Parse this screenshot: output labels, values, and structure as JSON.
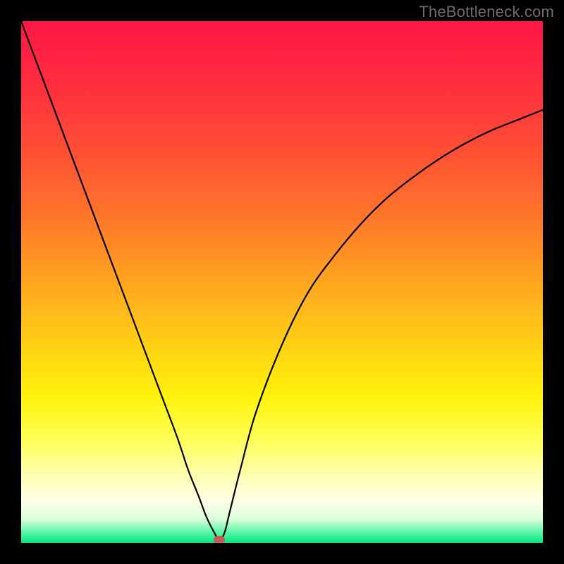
{
  "watermark": "TheBottleneck.com",
  "chart_data": {
    "type": "line",
    "title": "",
    "xlabel": "",
    "ylabel": "",
    "xlim": [
      0,
      100
    ],
    "ylim": [
      0,
      100
    ],
    "grid": false,
    "legend": false,
    "background": {
      "gradient_stops": [
        {
          "pos": 0.0,
          "color": "#ff1745"
        },
        {
          "pos": 0.12,
          "color": "#ff2d3f"
        },
        {
          "pos": 0.25,
          "color": "#ff5034"
        },
        {
          "pos": 0.38,
          "color": "#ff782a"
        },
        {
          "pos": 0.5,
          "color": "#ffa51f"
        },
        {
          "pos": 0.62,
          "color": "#ffd014"
        },
        {
          "pos": 0.72,
          "color": "#fff20a"
        },
        {
          "pos": 0.8,
          "color": "#ffff55"
        },
        {
          "pos": 0.87,
          "color": "#ffffb0"
        },
        {
          "pos": 0.92,
          "color": "#ffffe6"
        },
        {
          "pos": 0.955,
          "color": "#d8ffd8"
        },
        {
          "pos": 0.975,
          "color": "#70f7b0"
        },
        {
          "pos": 1.0,
          "color": "#00e884"
        }
      ]
    },
    "series": [
      {
        "name": "bottleneck-curve",
        "color": "#000000",
        "x": [
          0.0,
          3.0,
          6.0,
          9.0,
          12.0,
          15.0,
          18.0,
          21.0,
          24.0,
          27.0,
          30.0,
          32.0,
          34.0,
          35.5,
          37.0,
          38.0,
          39.0,
          40.0,
          42.0,
          45.0,
          50.0,
          55.0,
          60.0,
          65.0,
          70.0,
          75.0,
          80.0,
          85.0,
          90.0,
          95.0,
          100.0
        ],
        "y": [
          100.0,
          92.0,
          84.0,
          76.0,
          68.0,
          60.0,
          52.0,
          44.0,
          36.0,
          28.0,
          20.0,
          14.0,
          9.0,
          5.0,
          2.0,
          0.5,
          2.0,
          6.0,
          14.0,
          25.0,
          38.0,
          48.0,
          55.0,
          61.0,
          66.0,
          70.0,
          73.5,
          76.5,
          79.0,
          81.0,
          83.0
        ]
      }
    ],
    "annotations": [
      {
        "name": "bottleneck-marker",
        "shape": "rounded-rect",
        "color": "#c45a56",
        "x": 38.0,
        "y": 0.5
      }
    ]
  }
}
